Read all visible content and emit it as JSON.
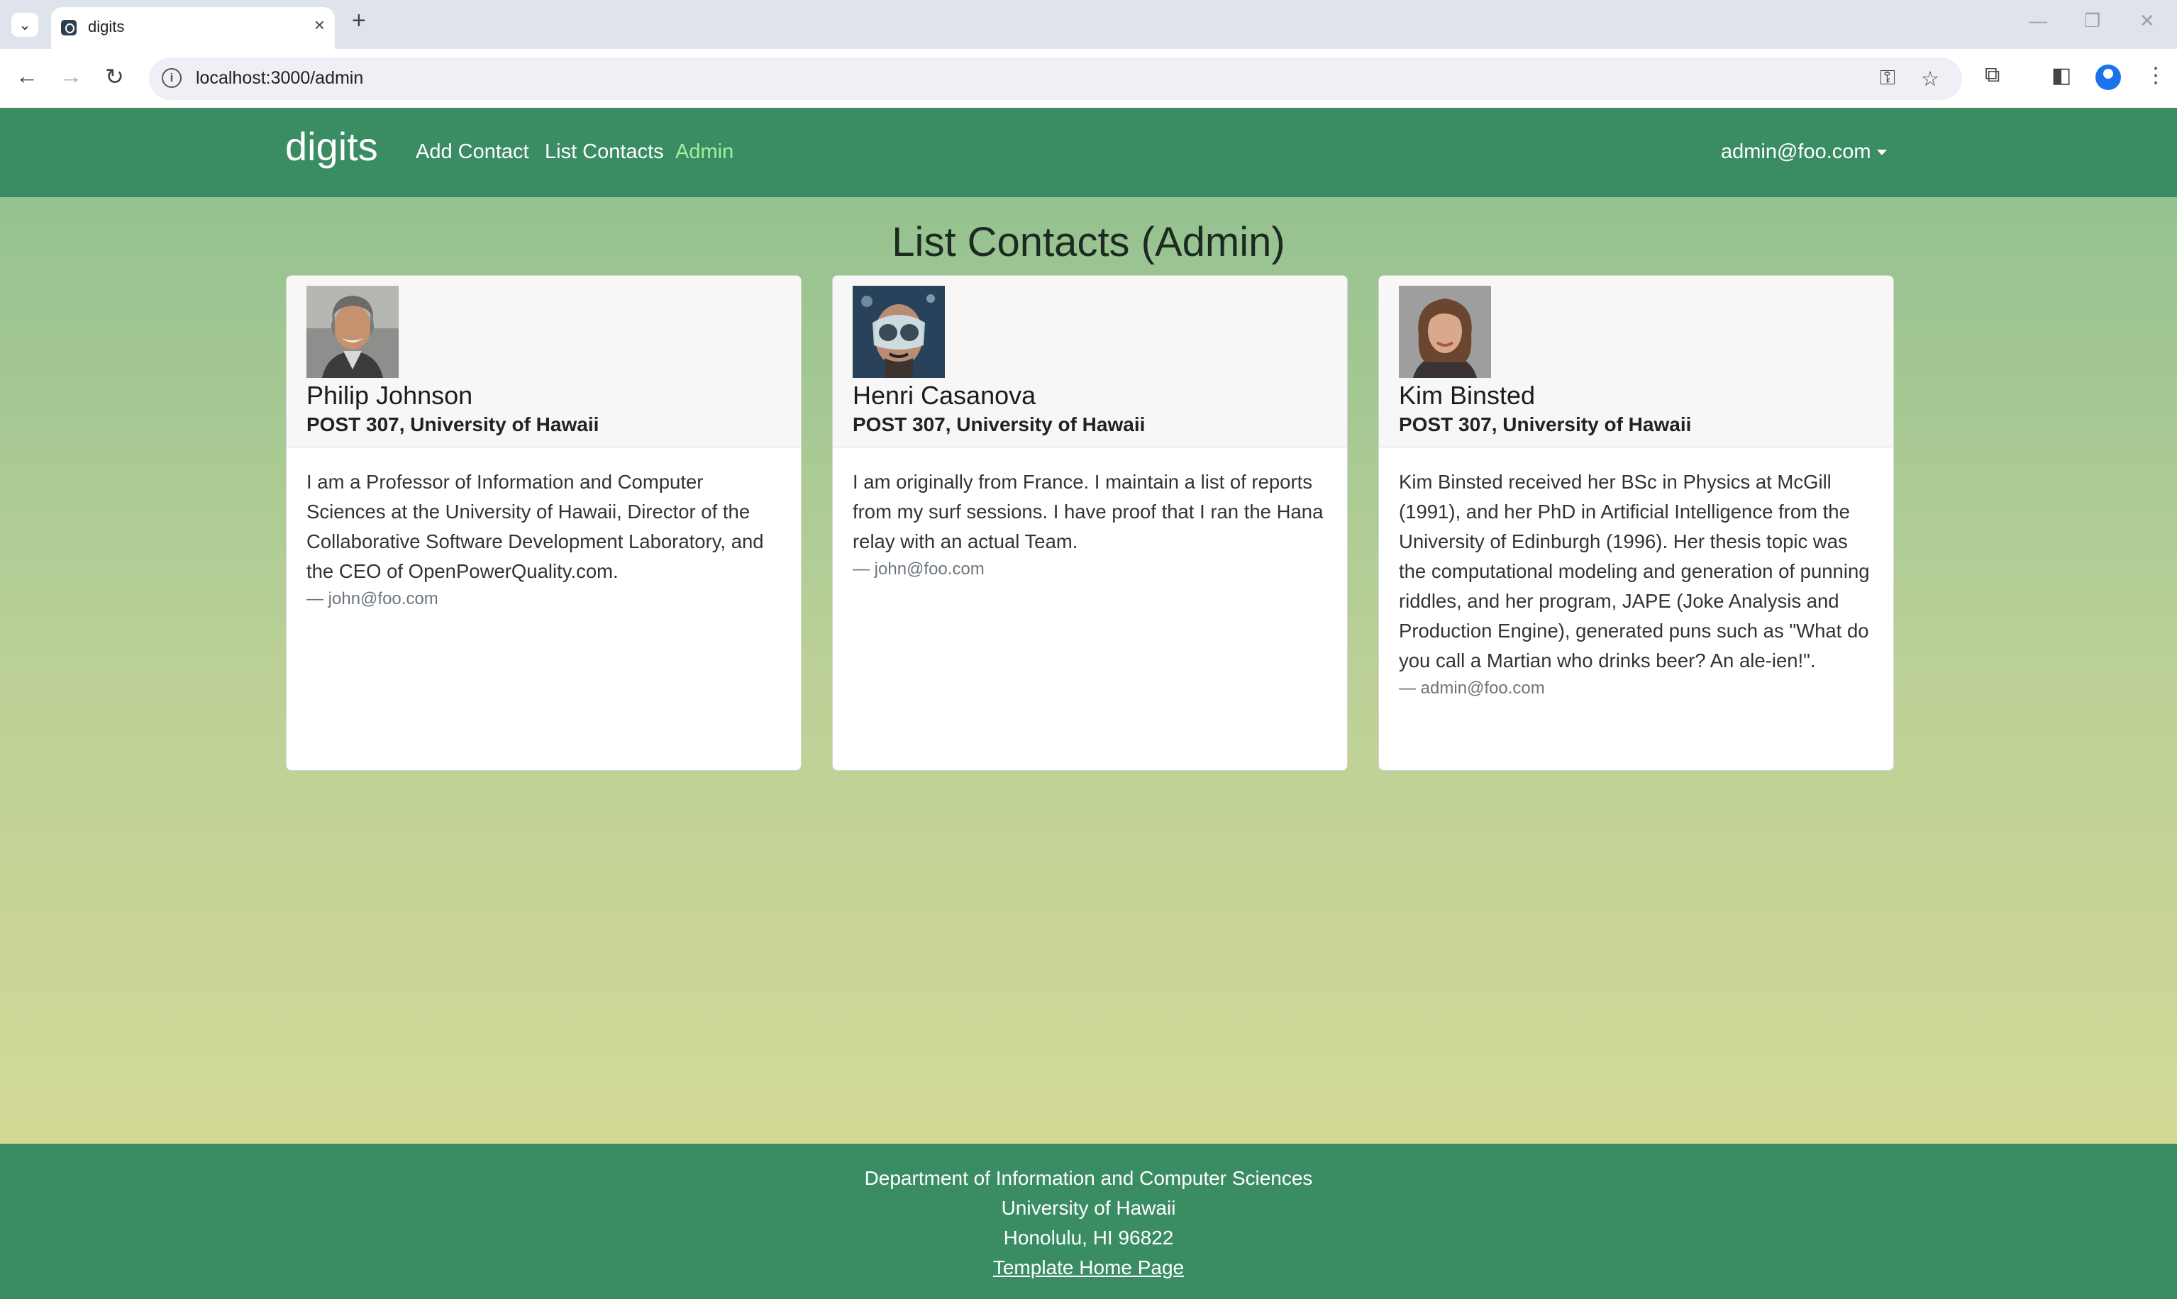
{
  "browser": {
    "tab_title": "digits",
    "url": "localhost:3000/admin"
  },
  "navbar": {
    "brand": "digits",
    "links": [
      "Add Contact",
      "List Contacts",
      "Admin"
    ],
    "user": "admin@foo.com",
    "accent_color": "#3a8c63",
    "active_link_color": "#9ff0a0"
  },
  "page": {
    "title": "List Contacts (Admin)"
  },
  "contacts": [
    {
      "name": "Philip Johnson",
      "address": "POST 307, University of Hawaii",
      "description": "I am a Professor of Information and Computer Sciences at the University of Hawaii, Director of the Collaborative Software Development Laboratory, and the CEO of OpenPowerQuality.com.",
      "owner": "— john@foo.com"
    },
    {
      "name": "Henri Casanova",
      "address": "POST 307, University of Hawaii",
      "description": "I am originally from France. I maintain a list of reports from my surf sessions. I have proof that I ran the Hana relay with an actual Team.",
      "owner": "— john@foo.com"
    },
    {
      "name": "Kim Binsted",
      "address": "POST 307, University of Hawaii",
      "description": "Kim Binsted received her BSc in Physics at McGill (1991), and her PhD in Artificial Intelligence from the University of Edinburgh (1996). Her thesis topic was the computational modeling and generation of punning riddles, and her program, JAPE (Joke Analysis and Production Engine), generated puns such as \"What do you call a Martian who drinks beer? An ale-ien!\".",
      "owner": "— admin@foo.com"
    }
  ],
  "footer": {
    "line1": "Department of Information and Computer Sciences",
    "line2": "University of Hawaii",
    "line3": "Honolulu, HI 96822",
    "link": "Template Home Page"
  }
}
